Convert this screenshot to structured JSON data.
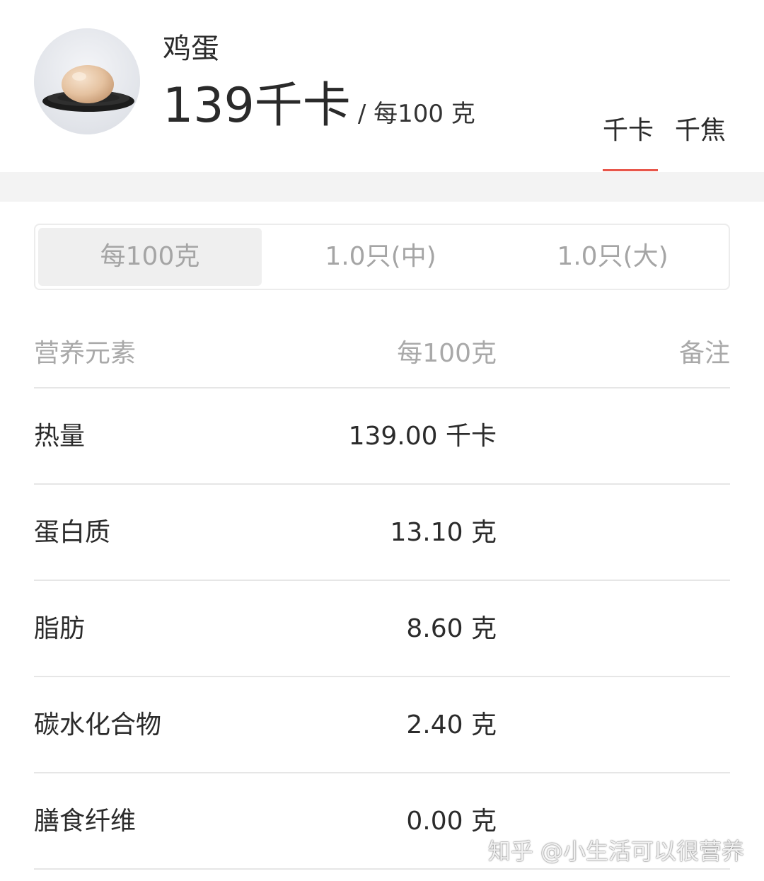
{
  "header": {
    "food_name": "鸡蛋",
    "calorie_value": "139",
    "calorie_unit": "千卡",
    "per_amount": "/ 每100 克",
    "unit_options": [
      "千卡",
      "千焦"
    ],
    "selected_unit": "千卡"
  },
  "serving_tabs": [
    {
      "label": "每100克",
      "selected": true
    },
    {
      "label": "1.0只(中)",
      "selected": false
    },
    {
      "label": "1.0只(大)",
      "selected": false
    }
  ],
  "table": {
    "headers": [
      "营养元素",
      "每100克",
      "备注"
    ],
    "rows": [
      {
        "name": "热量",
        "value": "139.00 千卡",
        "note": ""
      },
      {
        "name": "蛋白质",
        "value": "13.10 克",
        "note": ""
      },
      {
        "name": "脂肪",
        "value": "8.60 克",
        "note": ""
      },
      {
        "name": "碳水化合物",
        "value": "2.40 克",
        "note": ""
      },
      {
        "name": "膳食纤维",
        "value": "0.00 克",
        "note": ""
      }
    ]
  },
  "watermark": "知乎 @小生活可以很营养",
  "colors": {
    "accent": "#e8564a",
    "muted_text": "#a9a9a9",
    "divider": "#e6e6e6",
    "selected_tab_bg": "#efefef"
  },
  "icons": {
    "food_image": "egg-on-plate-icon"
  }
}
